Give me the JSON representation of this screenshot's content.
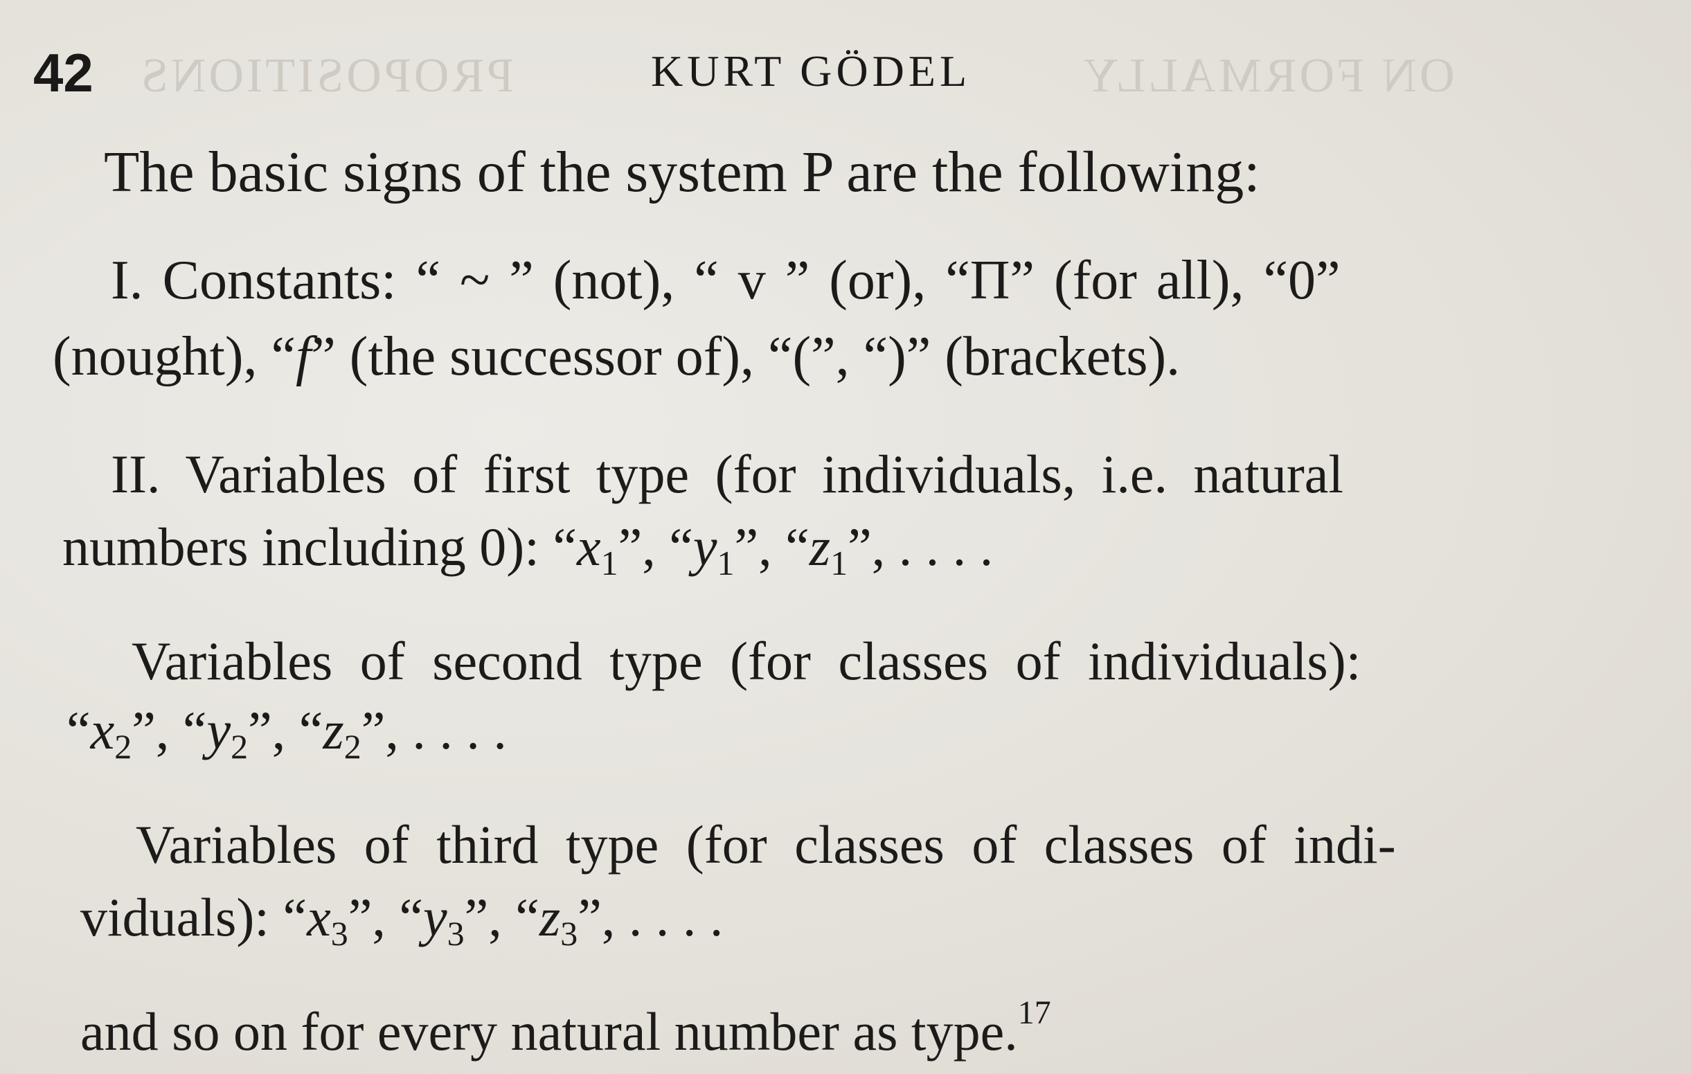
{
  "header": {
    "page_number": "42",
    "running_head": "KURT GÖDEL"
  },
  "ghost_text": {
    "left": "PROPOSITIONS",
    "right": "ON FORMALLY"
  },
  "body": {
    "intro": "The basic signs of the system P are the following:",
    "constants": {
      "p1": "I. Constants: “ ~ ” (not), “ v ” (or), “Π” (for all), “0”",
      "p2a": "(nought), “",
      "f": "f",
      "p2b": "” (the successor of), “(”, “)” (brackets)."
    },
    "first_type": {
      "l1": "II. Variables of first type (for individuals, i.e. natural",
      "l2_prefix": "numbers including 0): ",
      "vars": [
        {
          "name": "x",
          "sub": "1"
        },
        {
          "name": "y",
          "sub": "1"
        },
        {
          "name": "z",
          "sub": "1"
        }
      ]
    },
    "second_type": {
      "l1": "Variables of second type (for classes of individuals):",
      "vars": [
        {
          "name": "x",
          "sub": "2"
        },
        {
          "name": "y",
          "sub": "2"
        },
        {
          "name": "z",
          "sub": "2"
        }
      ]
    },
    "third_type": {
      "l1": "Variables of third type (for classes of classes of indi-",
      "l2_prefix": "viduals): ",
      "vars": [
        {
          "name": "x",
          "sub": "3"
        },
        {
          "name": "y",
          "sub": "3"
        },
        {
          "name": "z",
          "sub": "3"
        }
      ]
    },
    "closing": "and so on for every natural number as type.",
    "footnote_ref": "17",
    "ellipsis": ", . . . ."
  }
}
